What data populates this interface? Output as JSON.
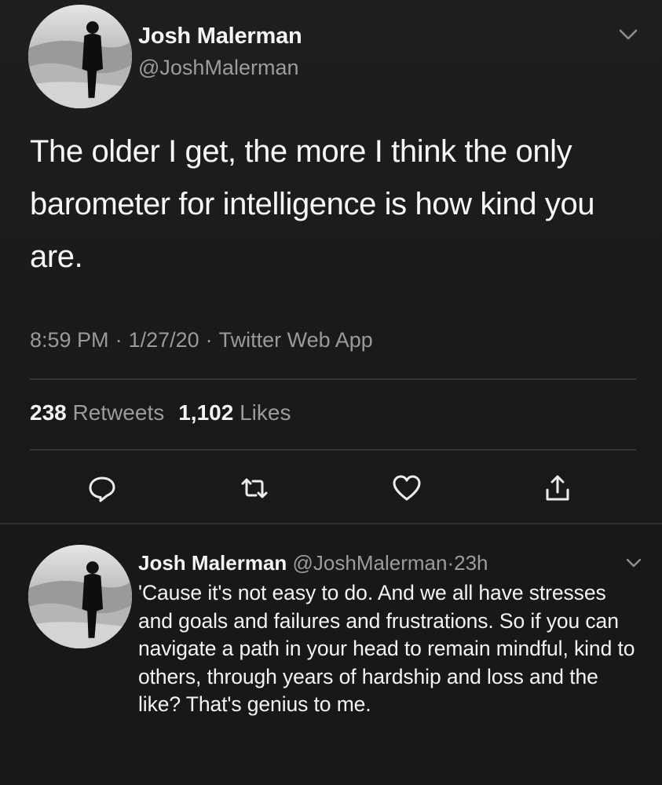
{
  "tweet": {
    "author_name": "Josh Malerman",
    "author_handle": "@JoshMalerman",
    "text": "The older I get, the more I think the only barometer for intelligence is how kind you are.",
    "time": "8:59 PM",
    "date": "1/27/20",
    "source": "Twitter Web App",
    "separator": "·",
    "retweets_count": "238",
    "retweets_label": "Retweets",
    "likes_count": "1,102",
    "likes_label": "Likes",
    "icons": {
      "more": "chevron-down-icon",
      "reply": "reply-icon",
      "retweet": "retweet-icon",
      "like": "heart-icon",
      "share": "share-icon"
    }
  },
  "reply": {
    "author_name": "Josh Malerman",
    "author_handle": "@JoshMalerman",
    "separator": "·",
    "time_ago": "23h",
    "text": "'Cause it's not easy to do. And we all have stresses and goals and failures and frustrations. So if you can navigate a path in your head to remain mindful, kind to others, through years of hardship and loss and the like? That's genius to me."
  },
  "colors": {
    "background": "#1b1a1b",
    "primary_text": "#f5f5f5",
    "secondary_text": "#9c9c9c",
    "divider": "#353435"
  }
}
